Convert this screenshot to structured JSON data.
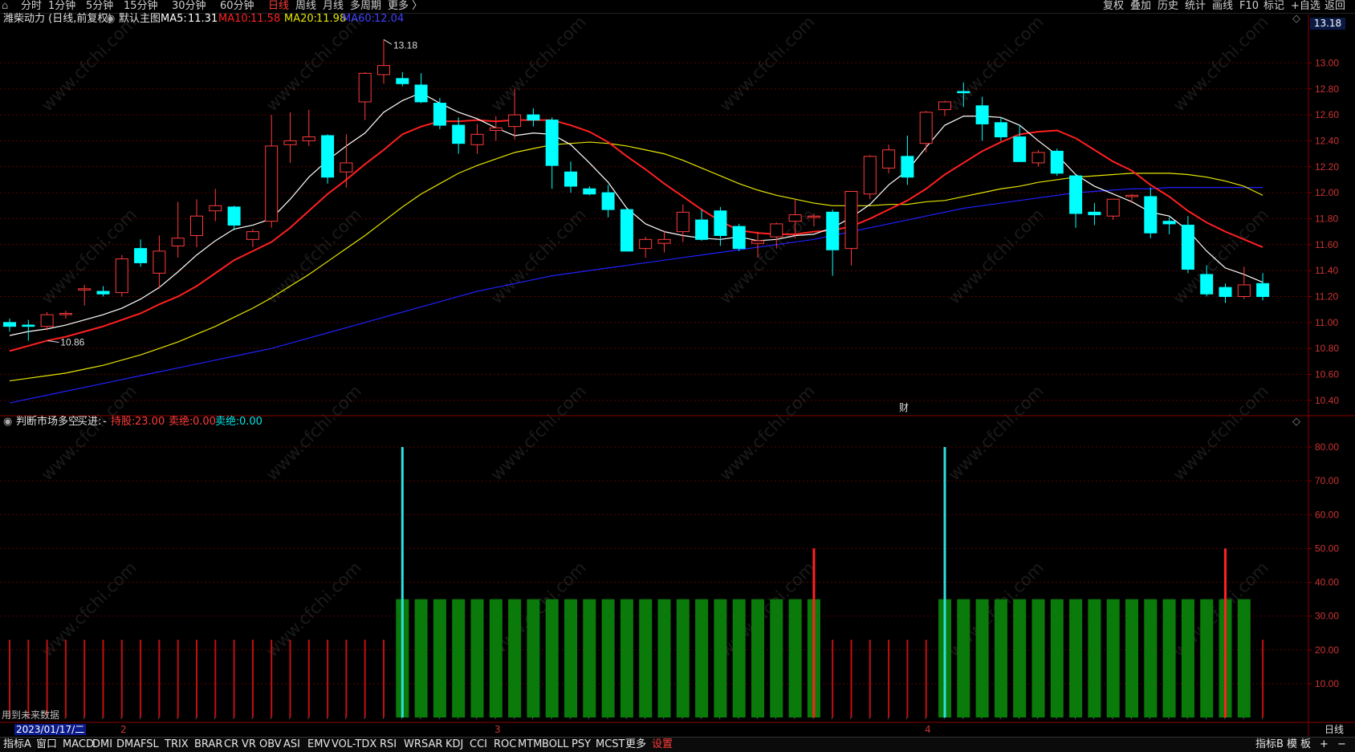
{
  "toolbar": {
    "logo": "⌂",
    "periods": [
      "分时",
      "1分钟",
      "5分钟",
      "15分钟",
      "30分钟",
      "60分钟",
      "日线",
      "周线",
      "月线",
      "多周期",
      "更多 〉"
    ],
    "active_period": "日线",
    "right_items": [
      "复权",
      "叠加",
      "历史",
      "统计",
      "画线",
      "F10",
      "标记",
      "+自选",
      "返回"
    ]
  },
  "main_legend": {
    "stock": "潍柴动力 (日线,前复权)",
    "template": "默认主图",
    "ma5_label": "MA5:",
    "ma5": "11.31",
    "ma10_label": "MA10:",
    "ma10": "11.58",
    "ma20_label": "MA20:",
    "ma20": "11.98",
    "ma60_label": "MA60:",
    "ma60": "12.04",
    "current_price": "13.18"
  },
  "price_axis_labels": [
    "13.00",
    "12.80",
    "12.60",
    "12.40",
    "12.20",
    "12.00",
    "11.80",
    "11.60",
    "11.40",
    "11.20",
    "11.00",
    "10.80",
    "10.60",
    "10.40"
  ],
  "annotations": {
    "high": "13.18",
    "low": "10.86",
    "fin_mark": "财"
  },
  "indicator_legend": {
    "name": "判断市场多空",
    "buy_label": "买进:",
    "buy_value": "-",
    "hold_label": "持股:",
    "hold_value": "23.00",
    "sell_label": "卖绝:",
    "sell_value": "0.00",
    "sellout_label": "卖绝:",
    "sellout_value": "0.00"
  },
  "indicator_axis_labels": [
    "80.00",
    "70.00",
    "60.00",
    "50.00",
    "40.00",
    "30.00",
    "20.00",
    "10.00"
  ],
  "bottom_left_note": "用到未来数据",
  "date_bar": {
    "cursor_date": "2023/01/17/二",
    "month_marks": [
      "2",
      "3",
      "4"
    ],
    "period_label": "日线"
  },
  "bottom_tabs": {
    "left": [
      "指标A",
      "窗口",
      "MACD",
      "DMI",
      "DMA",
      "FSL",
      "TRIX",
      "BRAR",
      "CR",
      "VR",
      "OBV",
      "ASI",
      "EMV",
      "VOL-TDX",
      "RSI",
      "WR",
      "SAR",
      "KDJ",
      "CCI",
      "ROC",
      "MTM",
      "BOLL",
      "PSY",
      "MCST",
      "更多",
      "设置"
    ],
    "right": [
      "指标B",
      "模",
      "板",
      "+",
      "−"
    ]
  },
  "watermark": "www.cfchi.com",
  "colors": {
    "up": "#ff3b3b",
    "down": "#00ffff",
    "ma5": "#ffffff",
    "ma10": "#ff2020",
    "ma20": "#e6e600",
    "ma60": "#2020ff",
    "hold_bar": "#0a7a0a"
  },
  "chart_data": {
    "type": "candlestick",
    "ylim": [
      10.3,
      13.25
    ],
    "candles": [
      {
        "o": 11.0,
        "h": 11.03,
        "l": 10.93,
        "c": 10.97
      },
      {
        "o": 10.98,
        "h": 11.02,
        "l": 10.86,
        "c": 10.97
      },
      {
        "o": 10.97,
        "h": 11.08,
        "l": 10.94,
        "c": 11.06
      },
      {
        "o": 11.06,
        "h": 11.09,
        "l": 11.03,
        "c": 11.07
      },
      {
        "o": 11.25,
        "h": 11.29,
        "l": 11.13,
        "c": 11.26
      },
      {
        "o": 11.24,
        "h": 11.28,
        "l": 11.2,
        "c": 11.22
      },
      {
        "o": 11.23,
        "h": 11.52,
        "l": 11.2,
        "c": 11.49
      },
      {
        "o": 11.57,
        "h": 11.64,
        "l": 11.43,
        "c": 11.46
      },
      {
        "o": 11.38,
        "h": 11.67,
        "l": 11.26,
        "c": 11.55
      },
      {
        "o": 11.59,
        "h": 11.93,
        "l": 11.5,
        "c": 11.65
      },
      {
        "o": 11.67,
        "h": 11.95,
        "l": 11.58,
        "c": 11.82
      },
      {
        "o": 11.86,
        "h": 12.03,
        "l": 11.78,
        "c": 11.9
      },
      {
        "o": 11.89,
        "h": 11.9,
        "l": 11.71,
        "c": 11.75
      },
      {
        "o": 11.64,
        "h": 11.72,
        "l": 11.58,
        "c": 11.7
      },
      {
        "o": 11.78,
        "h": 12.6,
        "l": 11.73,
        "c": 12.36
      },
      {
        "o": 12.37,
        "h": 12.62,
        "l": 12.23,
        "c": 12.4
      },
      {
        "o": 12.4,
        "h": 12.64,
        "l": 12.36,
        "c": 12.43
      },
      {
        "o": 12.44,
        "h": 12.45,
        "l": 12.07,
        "c": 12.12
      },
      {
        "o": 12.16,
        "h": 12.45,
        "l": 12.04,
        "c": 12.23
      },
      {
        "o": 12.7,
        "h": 12.93,
        "l": 12.56,
        "c": 12.92
      },
      {
        "o": 12.91,
        "h": 13.18,
        "l": 12.84,
        "c": 12.98
      },
      {
        "o": 12.88,
        "h": 12.93,
        "l": 12.82,
        "c": 12.84
      },
      {
        "o": 12.83,
        "h": 12.92,
        "l": 12.69,
        "c": 12.7
      },
      {
        "o": 12.69,
        "h": 12.73,
        "l": 12.49,
        "c": 12.52
      },
      {
        "o": 12.52,
        "h": 12.58,
        "l": 12.3,
        "c": 12.38
      },
      {
        "o": 12.37,
        "h": 12.53,
        "l": 12.3,
        "c": 12.45
      },
      {
        "o": 12.48,
        "h": 12.59,
        "l": 12.4,
        "c": 12.5
      },
      {
        "o": 12.51,
        "h": 12.8,
        "l": 12.41,
        "c": 12.6
      },
      {
        "o": 12.6,
        "h": 12.65,
        "l": 12.51,
        "c": 12.56
      },
      {
        "o": 12.56,
        "h": 12.58,
        "l": 12.03,
        "c": 12.21
      },
      {
        "o": 12.16,
        "h": 12.24,
        "l": 12.0,
        "c": 12.05
      },
      {
        "o": 12.03,
        "h": 12.05,
        "l": 11.98,
        "c": 11.99
      },
      {
        "o": 12.0,
        "h": 12.06,
        "l": 11.81,
        "c": 11.87
      },
      {
        "o": 11.87,
        "h": 11.88,
        "l": 11.55,
        "c": 11.55
      },
      {
        "o": 11.57,
        "h": 11.66,
        "l": 11.5,
        "c": 11.64
      },
      {
        "o": 11.61,
        "h": 11.71,
        "l": 11.54,
        "c": 11.64
      },
      {
        "o": 11.7,
        "h": 11.91,
        "l": 11.62,
        "c": 11.85
      },
      {
        "o": 11.79,
        "h": 11.87,
        "l": 11.63,
        "c": 11.64
      },
      {
        "o": 11.86,
        "h": 11.89,
        "l": 11.59,
        "c": 11.67
      },
      {
        "o": 11.74,
        "h": 11.76,
        "l": 11.55,
        "c": 11.57
      },
      {
        "o": 11.61,
        "h": 11.7,
        "l": 11.5,
        "c": 11.63
      },
      {
        "o": 11.66,
        "h": 11.77,
        "l": 11.57,
        "c": 11.76
      },
      {
        "o": 11.78,
        "h": 11.95,
        "l": 11.65,
        "c": 11.83
      },
      {
        "o": 11.81,
        "h": 11.84,
        "l": 11.74,
        "c": 11.82
      },
      {
        "o": 11.85,
        "h": 11.87,
        "l": 11.36,
        "c": 11.56
      },
      {
        "o": 11.57,
        "h": 12.01,
        "l": 11.44,
        "c": 12.01
      },
      {
        "o": 11.99,
        "h": 12.29,
        "l": 11.95,
        "c": 12.28
      },
      {
        "o": 12.19,
        "h": 12.37,
        "l": 12.15,
        "c": 12.33
      },
      {
        "o": 12.28,
        "h": 12.44,
        "l": 12.06,
        "c": 12.12
      },
      {
        "o": 12.38,
        "h": 12.63,
        "l": 12.31,
        "c": 12.62
      },
      {
        "o": 12.64,
        "h": 12.71,
        "l": 12.59,
        "c": 12.7
      },
      {
        "o": 12.78,
        "h": 12.85,
        "l": 12.66,
        "c": 12.77
      },
      {
        "o": 12.67,
        "h": 12.74,
        "l": 12.4,
        "c": 12.53
      },
      {
        "o": 12.54,
        "h": 12.58,
        "l": 12.4,
        "c": 12.43
      },
      {
        "o": 12.43,
        "h": 12.52,
        "l": 12.3,
        "c": 12.24
      },
      {
        "o": 12.23,
        "h": 12.33,
        "l": 12.2,
        "c": 12.31
      },
      {
        "o": 12.32,
        "h": 12.34,
        "l": 12.13,
        "c": 12.15
      },
      {
        "o": 12.13,
        "h": 12.14,
        "l": 11.73,
        "c": 11.84
      },
      {
        "o": 11.85,
        "h": 11.92,
        "l": 11.75,
        "c": 11.83
      },
      {
        "o": 11.82,
        "h": 11.95,
        "l": 11.79,
        "c": 11.95
      },
      {
        "o": 11.97,
        "h": 11.99,
        "l": 11.92,
        "c": 11.98
      },
      {
        "o": 11.97,
        "h": 12.04,
        "l": 11.65,
        "c": 11.69
      },
      {
        "o": 11.78,
        "h": 11.81,
        "l": 11.68,
        "c": 11.76
      },
      {
        "o": 11.75,
        "h": 11.82,
        "l": 11.38,
        "c": 11.41
      },
      {
        "o": 11.37,
        "h": 11.44,
        "l": 11.2,
        "c": 11.22
      },
      {
        "o": 11.27,
        "h": 11.3,
        "l": 11.15,
        "c": 11.2
      },
      {
        "o": 11.2,
        "h": 11.43,
        "l": 11.18,
        "c": 11.29
      },
      {
        "o": 11.3,
        "h": 11.38,
        "l": 11.17,
        "c": 11.2
      }
    ],
    "ma5": [
      10.9,
      10.93,
      10.95,
      10.98,
      11.02,
      11.06,
      11.11,
      11.18,
      11.27,
      11.39,
      11.52,
      11.63,
      11.72,
      11.75,
      11.8,
      11.95,
      12.12,
      12.25,
      12.36,
      12.46,
      12.62,
      12.71,
      12.77,
      12.69,
      12.62,
      12.57,
      12.5,
      12.44,
      12.46,
      12.45,
      12.37,
      12.23,
      12.08,
      11.88,
      11.76,
      11.7,
      11.67,
      11.65,
      11.64,
      11.66,
      11.63,
      11.64,
      11.67,
      11.68,
      11.73,
      11.81,
      11.91,
      12.06,
      12.17,
      12.35,
      12.52,
      12.59,
      12.59,
      12.58,
      12.52,
      12.4,
      12.29,
      12.14,
      12.05,
      11.99,
      11.93,
      11.85,
      11.82,
      11.71,
      11.55,
      11.42,
      11.37,
      11.31
    ],
    "ma10": [
      10.78,
      10.82,
      10.86,
      10.89,
      10.93,
      10.97,
      11.02,
      11.07,
      11.14,
      11.2,
      11.28,
      11.38,
      11.48,
      11.55,
      11.62,
      11.73,
      11.86,
      11.99,
      12.1,
      12.22,
      12.33,
      12.45,
      12.51,
      12.55,
      12.55,
      12.56,
      12.55,
      12.56,
      12.56,
      12.56,
      12.52,
      12.47,
      12.39,
      12.28,
      12.18,
      12.07,
      11.97,
      11.87,
      11.78,
      11.71,
      11.69,
      11.68,
      11.68,
      11.7,
      11.71,
      11.74,
      11.8,
      11.87,
      11.94,
      12.03,
      12.14,
      12.23,
      12.32,
      12.39,
      12.45,
      12.47,
      12.48,
      12.42,
      12.33,
      12.24,
      12.17,
      12.06,
      11.97,
      11.86,
      11.77,
      11.7,
      11.64,
      11.58
    ],
    "ma20": [
      10.55,
      10.57,
      10.59,
      10.61,
      10.64,
      10.67,
      10.71,
      10.75,
      10.8,
      10.85,
      10.91,
      10.97,
      11.04,
      11.11,
      11.19,
      11.28,
      11.37,
      11.47,
      11.57,
      11.67,
      11.78,
      11.89,
      11.99,
      12.07,
      12.15,
      12.21,
      12.26,
      12.31,
      12.34,
      12.37,
      12.38,
      12.39,
      12.38,
      12.36,
      12.33,
      12.3,
      12.25,
      12.19,
      12.13,
      12.07,
      12.02,
      11.98,
      11.95,
      11.92,
      11.9,
      11.9,
      11.9,
      11.91,
      11.91,
      11.93,
      11.94,
      11.97,
      12.0,
      12.03,
      12.05,
      12.08,
      12.1,
      12.12,
      12.13,
      12.14,
      12.15,
      12.15,
      12.15,
      12.14,
      12.12,
      12.09,
      12.05,
      11.98
    ],
    "ma60": [
      10.38,
      10.41,
      10.44,
      10.47,
      10.5,
      10.53,
      10.56,
      10.59,
      10.62,
      10.65,
      10.68,
      10.71,
      10.74,
      10.77,
      10.8,
      10.84,
      10.88,
      10.92,
      10.96,
      11.0,
      11.04,
      11.08,
      11.12,
      11.16,
      11.2,
      11.24,
      11.27,
      11.3,
      11.33,
      11.36,
      11.38,
      11.4,
      11.42,
      11.44,
      11.46,
      11.48,
      11.5,
      11.52,
      11.54,
      11.56,
      11.58,
      11.6,
      11.62,
      11.64,
      11.67,
      11.7,
      11.73,
      11.76,
      11.79,
      11.82,
      11.85,
      11.88,
      11.9,
      11.92,
      11.94,
      11.96,
      11.98,
      12.0,
      12.01,
      12.02,
      12.03,
      12.03,
      12.04,
      12.04,
      12.04,
      12.04,
      12.04,
      12.04
    ],
    "indicator": {
      "ylim": [
        0,
        85
      ],
      "hold_level": 35,
      "base_level": 23,
      "hold_ranges": [
        [
          21,
          43
        ],
        [
          50,
          66
        ]
      ],
      "signals": [
        {
          "i": 21,
          "v": 80,
          "type": "buy"
        },
        {
          "i": 43,
          "v": 50,
          "type": "sell"
        },
        {
          "i": 50,
          "v": 80,
          "type": "buy"
        },
        {
          "i": 65,
          "v": 50,
          "type": "sell"
        }
      ]
    }
  }
}
